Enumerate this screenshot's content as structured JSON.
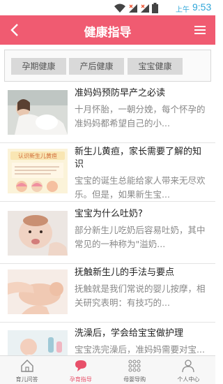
{
  "status_bar": {
    "ampm": "上午",
    "time": "9:53"
  },
  "header": {
    "title": "健康指导"
  },
  "tabs": [
    {
      "label": "孕期健康"
    },
    {
      "label": "产后健康"
    },
    {
      "label": "宝宝健康"
    }
  ],
  "articles": [
    {
      "title": "准妈妈预防早产之必读",
      "summary": "十月怀胎，一朝分娩，每个怀孕的准妈妈都希望自己的小..."
    },
    {
      "title": "新生儿黄疸，家长需要了解的知识",
      "summary": "宝宝的诞生总能给家人带来无尽欢乐。但是，如果新生宝...",
      "thumb_text": "认识新生儿黄疸"
    },
    {
      "title": "宝宝为什么吐奶?",
      "summary": "部分新生儿吃奶后容易吐奶，其中常见的一种称为\"溢奶..."
    },
    {
      "title": "抚触新生儿的手法与要点",
      "summary": "抚触就是我们常说的婴儿按摩，相关研究表明：有技巧的..."
    },
    {
      "title": "洗澡后，学会给宝宝做护理",
      "summary": "宝宝洗完澡后，准妈妈需要对宝..."
    }
  ],
  "bottom_nav": [
    {
      "label": "育儿问答",
      "icon": "home-icon"
    },
    {
      "label": "孕育指导",
      "icon": "chat-bubble-icon",
      "active": true
    },
    {
      "label": "母婴导购",
      "icon": "grid-icon"
    },
    {
      "label": "个人中心",
      "icon": "person-icon"
    }
  ],
  "colors": {
    "brand": "#f05b71",
    "active_tab_text": "#e8506a",
    "status_text": "#2fa6d9"
  }
}
